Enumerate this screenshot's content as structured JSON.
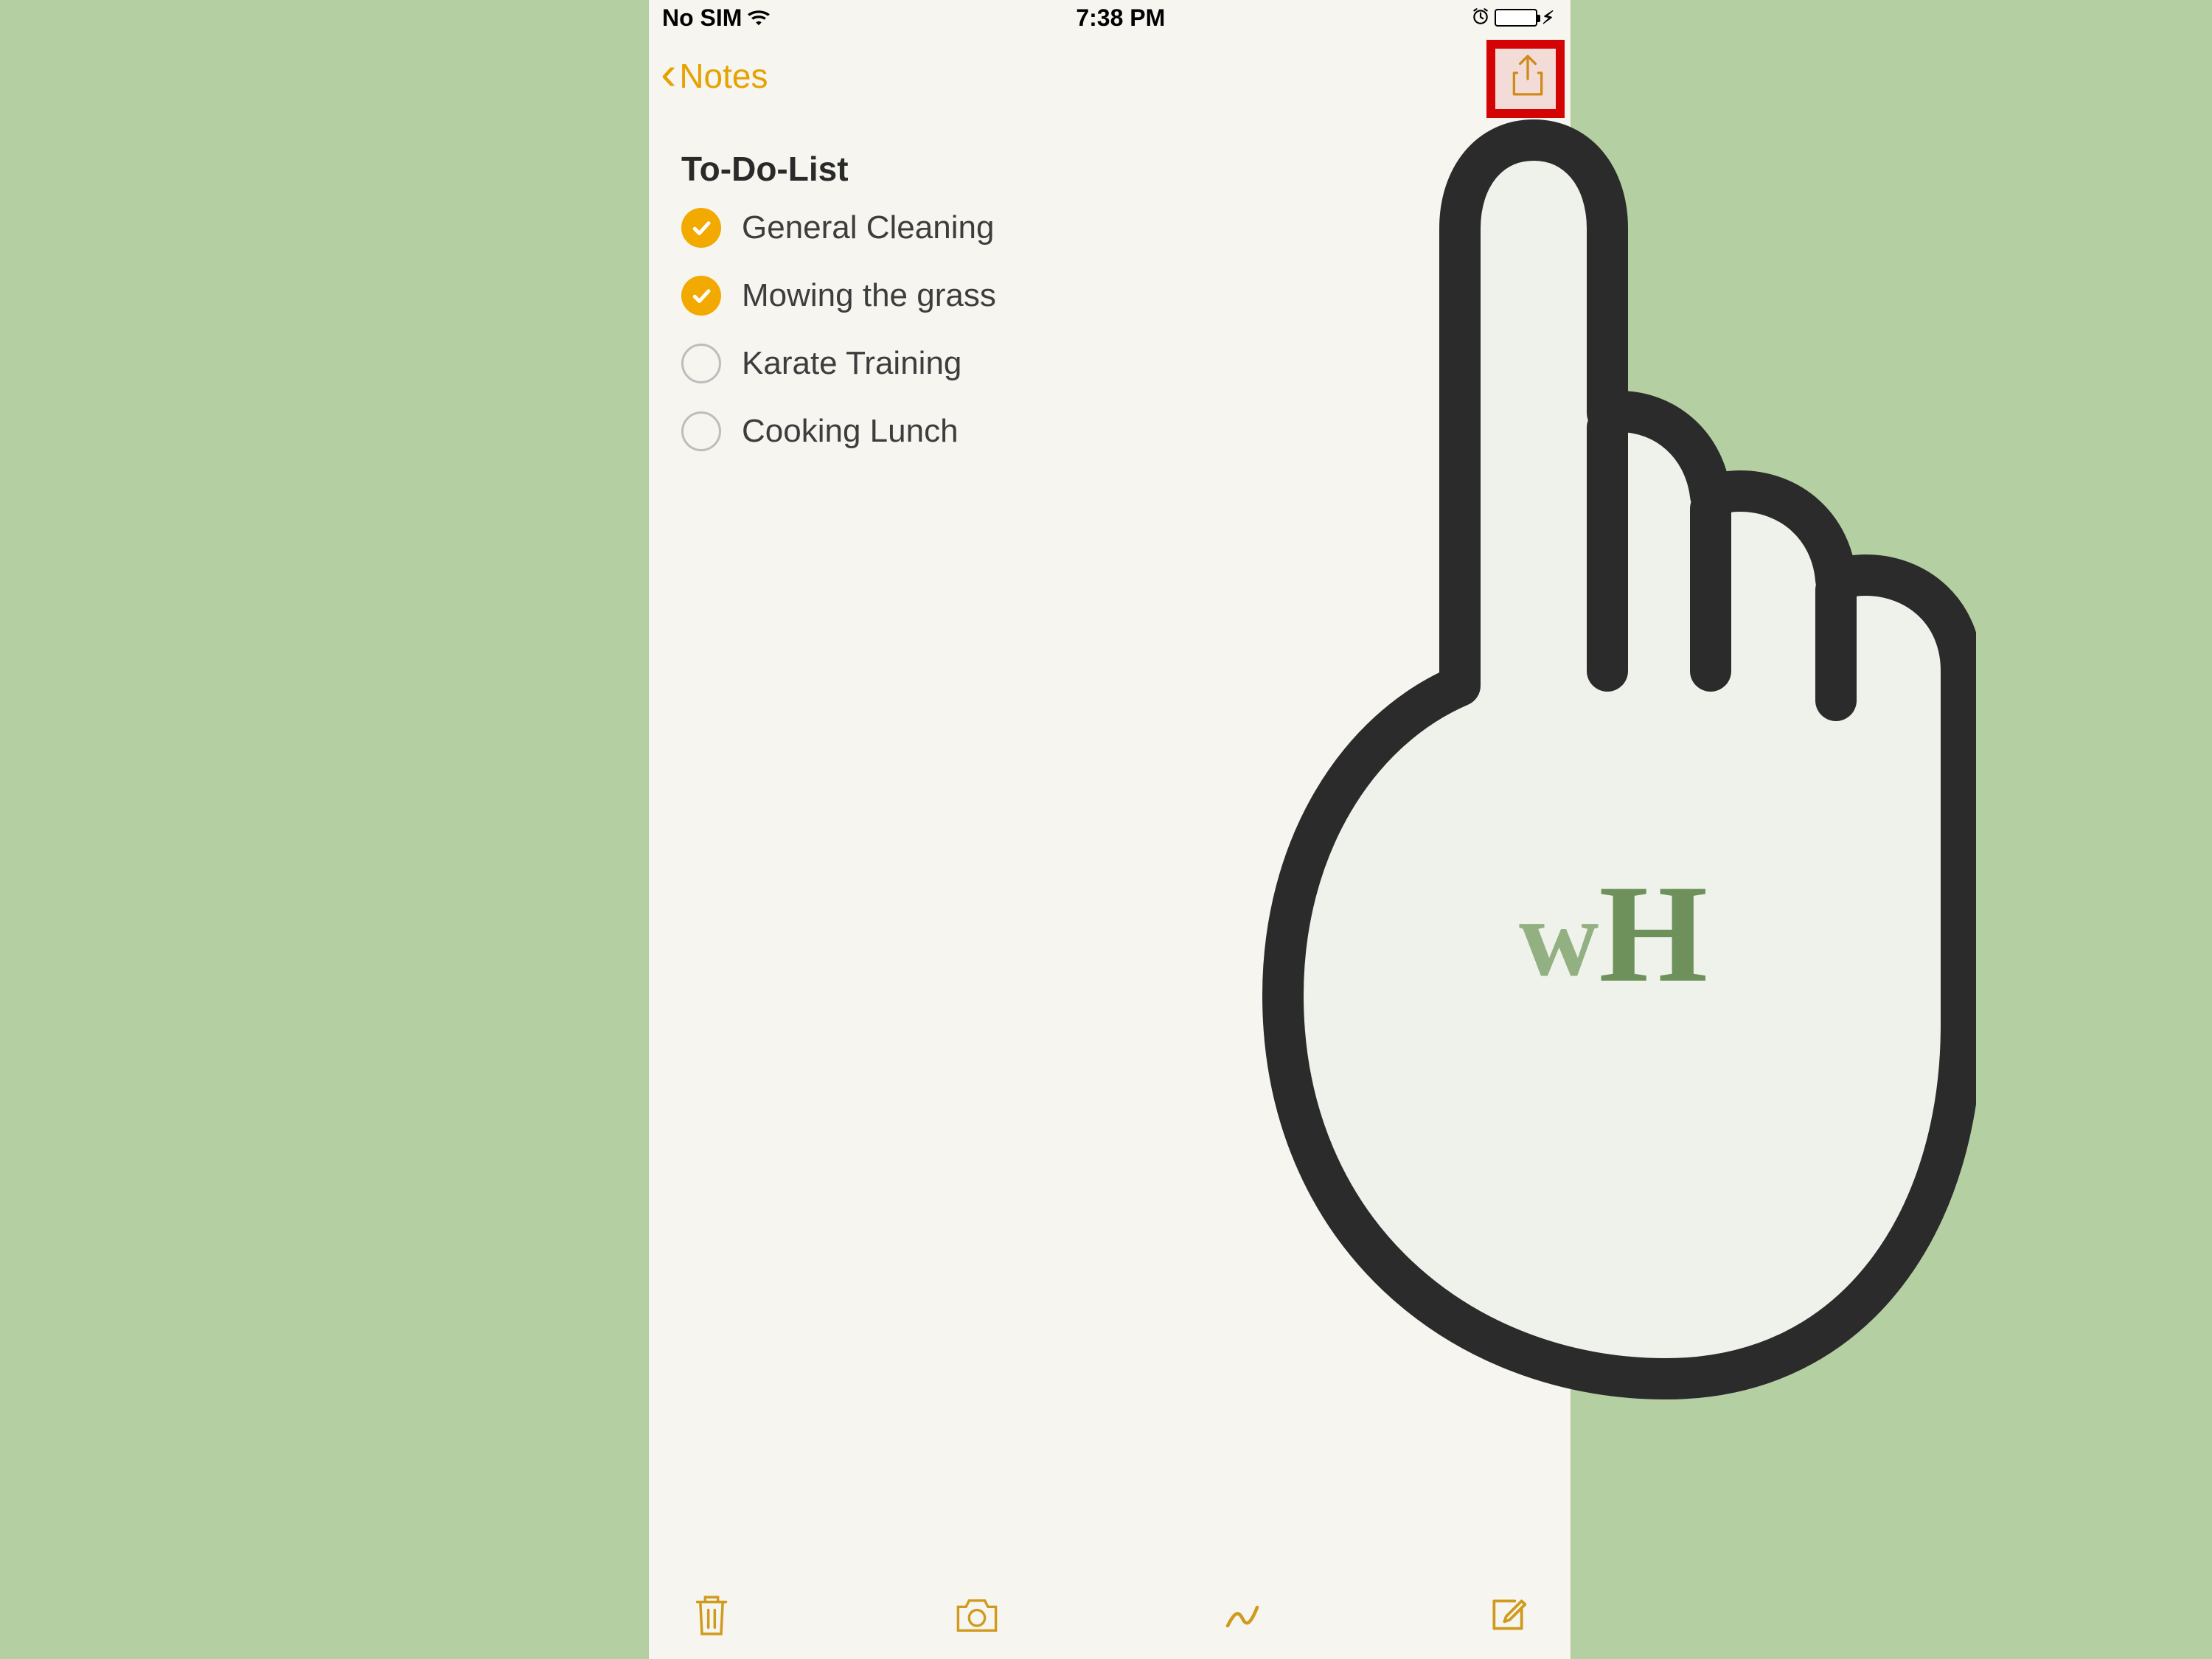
{
  "status": {
    "carrier": "No SIM",
    "time": "7:38 PM"
  },
  "nav": {
    "back_label": "Notes"
  },
  "note": {
    "title": "To-Do-List",
    "items": [
      {
        "label": "General Cleaning",
        "checked": true
      },
      {
        "label": "Mowing the grass",
        "checked": true
      },
      {
        "label": "Karate Training",
        "checked": false
      },
      {
        "label": "Cooking Lunch",
        "checked": false
      }
    ]
  },
  "watermark": {
    "w": "w",
    "H": "H"
  },
  "colors": {
    "notes_tint": "#e5a200",
    "highlight_red": "#d40404",
    "background": "#b4cfa1",
    "battery_green": "#36c24a"
  }
}
